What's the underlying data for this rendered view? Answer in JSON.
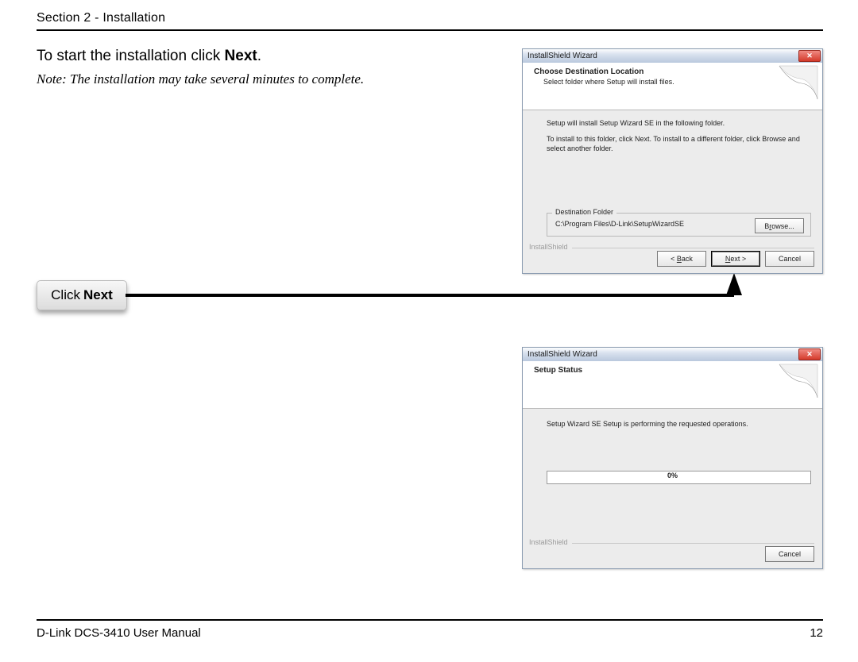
{
  "header": "Section 2 - Installation",
  "intro_prefix": "To start the installation click ",
  "intro_bold": "Next",
  "intro_suffix": ".",
  "note": "Note: The installation may take several minutes to complete.",
  "callout_prefix": "Click ",
  "callout_bold": "Next",
  "footer_left": "D-Link DCS-3410 User Manual",
  "footer_right": "12",
  "dlg1": {
    "title": "InstallShield Wizard",
    "banner_title": "Choose Destination Location",
    "banner_sub": "Select folder where Setup will install files.",
    "p1": "Setup will install Setup Wizard SE in the following folder.",
    "p2": "To install to this folder, click Next. To install to a different folder, click Browse and select another folder.",
    "dest_legend": "Destination Folder",
    "dest_path": "C:\\Program Files\\D-Link\\SetupWizardSE",
    "browse": "Browse...",
    "install_shield": "InstallShield",
    "btn_back": "< Back",
    "btn_next": "Next >",
    "btn_cancel": "Cancel"
  },
  "dlg2": {
    "title": "InstallShield Wizard",
    "banner_title": "Setup Status",
    "p1": "Setup Wizard SE Setup is performing the requested operations.",
    "progress": "0%",
    "install_shield": "InstallShield",
    "btn_cancel": "Cancel"
  }
}
